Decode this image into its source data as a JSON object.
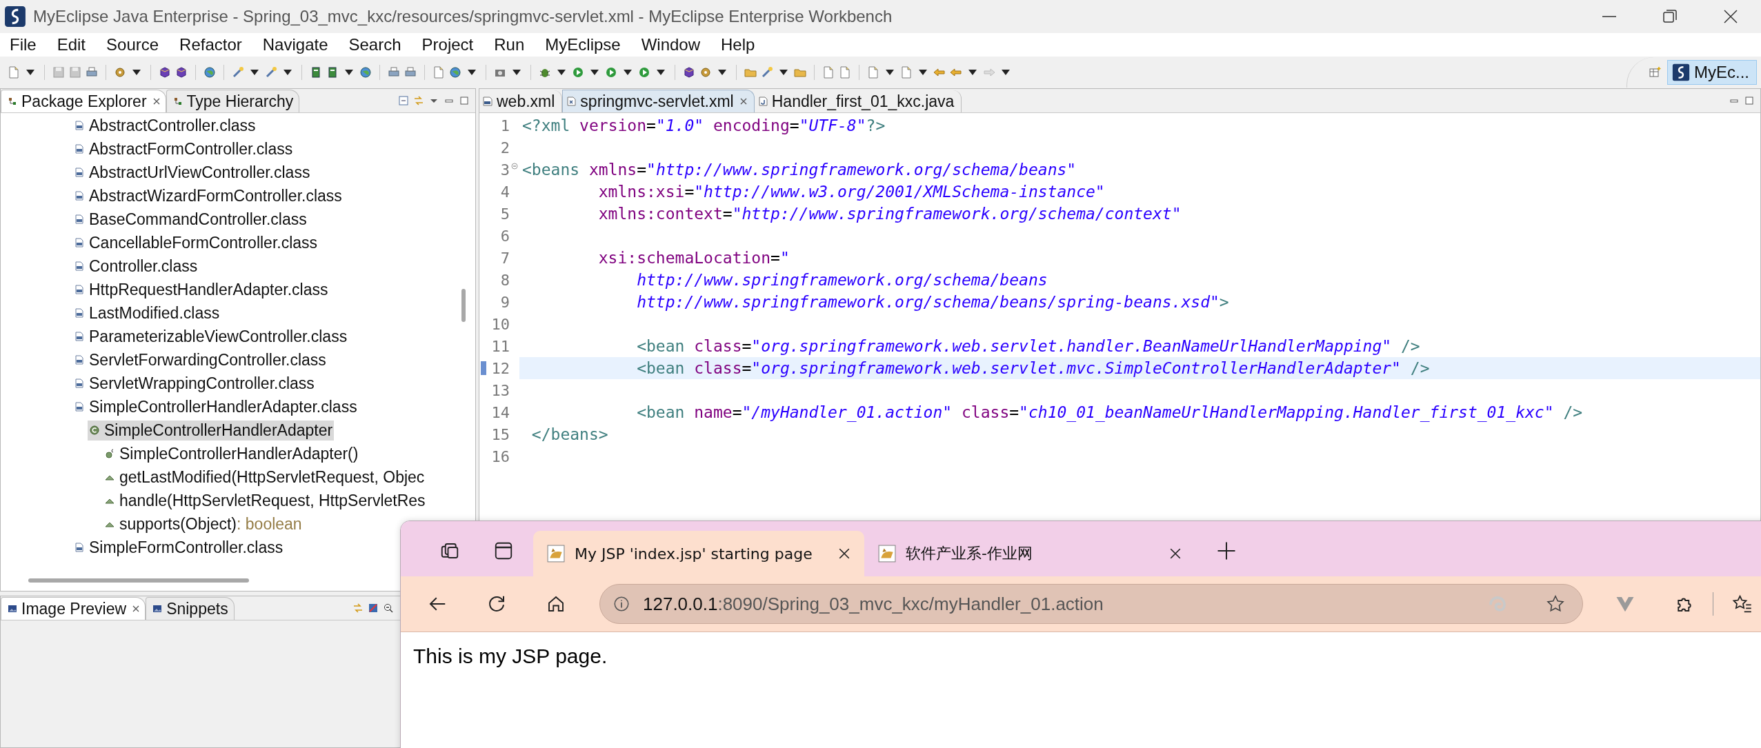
{
  "window": {
    "title": "MyEclipse Java Enterprise - Spring_03_mvc_kxc/resources/springmvc-servlet.xml - MyEclipse Enterprise Workbench"
  },
  "menu": [
    "File",
    "Edit",
    "Source",
    "Refactor",
    "Navigate",
    "Search",
    "Project",
    "Run",
    "MyEclipse",
    "Window",
    "Help"
  ],
  "perspective": {
    "label": "MyEc...",
    "selected": true
  },
  "explorer": {
    "tabs": [
      {
        "label": "Package Explorer",
        "selected": true
      },
      {
        "label": "Type Hierarchy",
        "selected": false
      }
    ],
    "tree": [
      {
        "label": "AbstractController.class",
        "kind": "classfile",
        "selected": false
      },
      {
        "label": "AbstractFormController.class",
        "kind": "classfile",
        "selected": false
      },
      {
        "label": "AbstractUrlViewController.class",
        "kind": "classfile",
        "selected": false
      },
      {
        "label": "AbstractWizardFormController.class",
        "kind": "classfile",
        "selected": false
      },
      {
        "label": "BaseCommandController.class",
        "kind": "classfile",
        "selected": false
      },
      {
        "label": "CancellableFormController.class",
        "kind": "classfile",
        "selected": false
      },
      {
        "label": "Controller.class",
        "kind": "classfile",
        "selected": false
      },
      {
        "label": "HttpRequestHandlerAdapter.class",
        "kind": "classfile",
        "selected": false
      },
      {
        "label": "LastModified.class",
        "kind": "classfile",
        "selected": false
      },
      {
        "label": "ParameterizableViewController.class",
        "kind": "classfile",
        "selected": false
      },
      {
        "label": "ServletForwardingController.class",
        "kind": "classfile",
        "selected": false
      },
      {
        "label": "ServletWrappingController.class",
        "kind": "classfile",
        "selected": false
      },
      {
        "label": "SimpleControllerHandlerAdapter.class",
        "kind": "classfile",
        "selected": false,
        "children": [
          {
            "label": "SimpleControllerHandlerAdapter",
            "kind": "class",
            "selected": true,
            "children": [
              {
                "label": "SimpleControllerHandlerAdapter()",
                "kind": "constructor",
                "selected": false
              },
              {
                "label": "getLastModified(HttpServletRequest, Objec",
                "kind": "method",
                "selected": false
              },
              {
                "label": "handle(HttpServletRequest, HttpServletRes",
                "kind": "method",
                "selected": false
              },
              {
                "label": "supports(Object)",
                "return_type": ": boolean",
                "kind": "method",
                "selected": false
              }
            ]
          }
        ]
      },
      {
        "label": "SimpleFormController.class",
        "kind": "classfile",
        "selected": false
      }
    ]
  },
  "lower_panel": {
    "tabs": [
      {
        "label": "Image Preview",
        "selected": true
      },
      {
        "label": "Snippets",
        "selected": false
      }
    ]
  },
  "editor": {
    "tabs": [
      {
        "label": "web.xml",
        "kind": "webxml",
        "selected": false
      },
      {
        "label": "springmvc-servlet.xml",
        "kind": "xml",
        "selected": true
      },
      {
        "label": "Handler_first_01_kxc.java",
        "kind": "java",
        "selected": false
      }
    ],
    "lines": [
      {
        "n": "1",
        "selected": false,
        "foldable": false,
        "tokens": [
          {
            "kind": "tag",
            "t": "<?xml "
          },
          {
            "kind": "attr",
            "t": "version"
          },
          {
            "kind": "punct",
            "t": "="
          },
          {
            "kind": "value",
            "t": "\"1.0\" "
          },
          {
            "kind": "attr",
            "t": "encoding"
          },
          {
            "kind": "punct",
            "t": "="
          },
          {
            "kind": "value",
            "t": "\"UTF-8\""
          },
          {
            "kind": "tag",
            "t": "?>"
          }
        ]
      },
      {
        "n": "2",
        "selected": false,
        "foldable": false
      },
      {
        "n": "3",
        "selected": false,
        "foldable": true,
        "tokens": [
          {
            "kind": "tag",
            "t": "<beans "
          },
          {
            "kind": "attr",
            "t": "xmlns"
          },
          {
            "kind": "punct",
            "t": "="
          },
          {
            "kind": "value",
            "t": "\"http://www.springframework.org/schema/beans\""
          }
        ]
      },
      {
        "n": "4",
        "selected": false,
        "foldable": false,
        "tokens": [
          {
            "kind": "attr",
            "t": "        xmlns:xsi"
          },
          {
            "kind": "punct",
            "t": "="
          },
          {
            "kind": "value",
            "t": "\"http://www.w3.org/2001/XMLSchema-instance\""
          }
        ]
      },
      {
        "n": "5",
        "selected": false,
        "foldable": false,
        "tokens": [
          {
            "kind": "attr",
            "t": "        xmlns:context"
          },
          {
            "kind": "punct",
            "t": "="
          },
          {
            "kind": "value",
            "t": "\"http://www.springframework.org/schema/context\""
          }
        ]
      },
      {
        "n": "6",
        "selected": false,
        "foldable": false
      },
      {
        "n": "7",
        "selected": false,
        "foldable": false,
        "tokens": [
          {
            "kind": "attr",
            "t": "        xsi:schemaLocation"
          },
          {
            "kind": "punct",
            "t": "="
          },
          {
            "kind": "value",
            "t": "\""
          }
        ]
      },
      {
        "n": "8",
        "selected": false,
        "foldable": false,
        "tokens": [
          {
            "kind": "value",
            "t": "            http://www.springframework.org/schema/beans"
          }
        ]
      },
      {
        "n": "9",
        "selected": false,
        "foldable": false,
        "tokens": [
          {
            "kind": "value",
            "t": "            http://www.springframework.org/schema/beans/spring-beans.xsd\""
          },
          {
            "kind": "tag",
            "t": ">"
          }
        ]
      },
      {
        "n": "10",
        "selected": false,
        "foldable": false
      },
      {
        "n": "11",
        "selected": false,
        "foldable": false,
        "tokens": [
          {
            "kind": "tag",
            "t": "            <bean "
          },
          {
            "kind": "attr",
            "t": "class"
          },
          {
            "kind": "punct",
            "t": "="
          },
          {
            "kind": "value",
            "t": "\"org.springframework.web.servlet.handler.BeanNameUrlHandlerMapping\""
          },
          {
            "kind": "tag",
            "t": " />"
          }
        ]
      },
      {
        "n": "12",
        "selected": true,
        "foldable": false,
        "tokens": [
          {
            "kind": "tag",
            "t": "            <bean "
          },
          {
            "kind": "attr",
            "t": "class"
          },
          {
            "kind": "punct",
            "t": "="
          },
          {
            "kind": "value",
            "t": "\"org.springframework.web.servlet.mvc.SimpleControllerHandlerAdapter\""
          },
          {
            "kind": "tag",
            "t": " />"
          }
        ]
      },
      {
        "n": "13",
        "selected": false,
        "foldable": false
      },
      {
        "n": "14",
        "selected": false,
        "foldable": false,
        "tokens": [
          {
            "kind": "tag",
            "t": "            <bean "
          },
          {
            "kind": "attr",
            "t": "name"
          },
          {
            "kind": "punct",
            "t": "="
          },
          {
            "kind": "value",
            "t": "\"/myHandler_01.action\" "
          },
          {
            "kind": "attr",
            "t": "class"
          },
          {
            "kind": "punct",
            "t": "="
          },
          {
            "kind": "value",
            "t": "\"ch10_01_beanNameUrlHandlerMapping.Handler_first_01_kxc\""
          },
          {
            "kind": "tag",
            "t": " />"
          }
        ]
      },
      {
        "n": "15",
        "selected": false,
        "foldable": false,
        "tokens": [
          {
            "kind": "tag",
            "t": " </beans>"
          }
        ]
      },
      {
        "n": "16",
        "selected": false,
        "foldable": false
      }
    ]
  },
  "browser": {
    "tabs": [
      {
        "title": "My JSP 'index.jsp' starting page",
        "selected": true
      },
      {
        "title": "软件产业系-作业网",
        "selected": false
      }
    ],
    "url_host": "127.0.0.1",
    "url_path": ":8090/Spring_03_mvc_kxc/myHandler_01.action",
    "body": "This is my JSP page."
  }
}
